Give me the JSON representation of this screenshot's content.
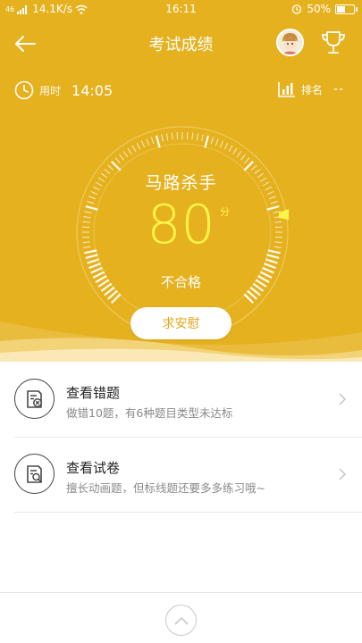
{
  "status_bar": {
    "signal": "46",
    "speed": "14.1K/s",
    "time": "16:11",
    "battery": "50%",
    "battery_level": 0.5
  },
  "nav": {
    "title": "考试成绩",
    "back_icon": "arrow-left-icon",
    "trophy_icon": "trophy-icon"
  },
  "info": {
    "time_label": "用时",
    "time_value": "14:05",
    "rank_label": "排名",
    "rank_value": "--"
  },
  "gauge": {
    "title": "马路杀手",
    "score": "80",
    "unit": "分",
    "result": "不合格",
    "score_fraction": 0.8
  },
  "comfort_button": "求安慰",
  "list": [
    {
      "title": "查看错题",
      "subtitle": "做错10题，有6种题目类型未达标",
      "icon": "wrong-questions-icon"
    },
    {
      "title": "查看试卷",
      "subtitle": "擅长动画题，但标线题还要多多练习哦~",
      "icon": "exam-paper-search-icon"
    }
  ],
  "colors": {
    "primary": "#e5b11f",
    "score": "#fff54a",
    "button_text": "#e2a617"
  }
}
